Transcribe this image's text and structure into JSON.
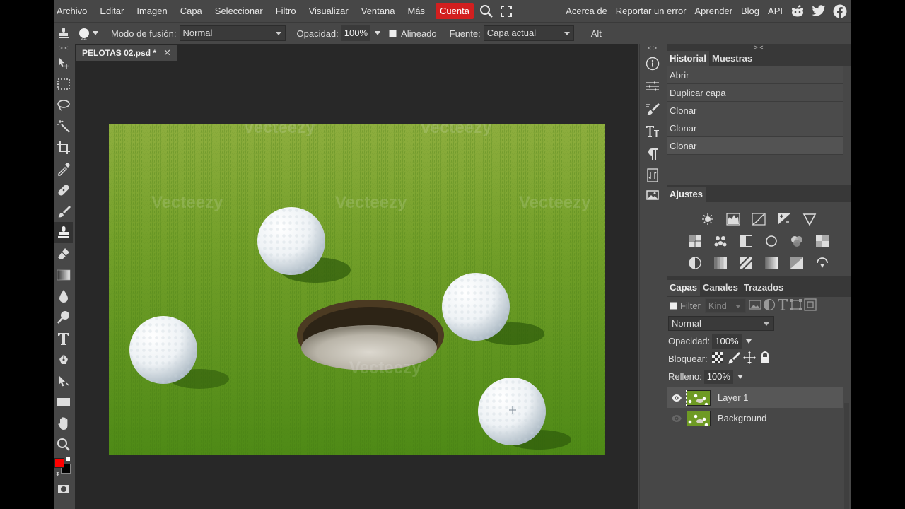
{
  "menu": {
    "items": [
      "Archivo",
      "Editar",
      "Imagen",
      "Capa",
      "Seleccionar",
      "Filtro",
      "Visualizar",
      "Ventana",
      "Más"
    ],
    "account": "Cuenta",
    "right_links": [
      "Acerca de",
      "Reportar un error",
      "Aprender",
      "Blog",
      "API"
    ],
    "social_icons": [
      "reddit-icon",
      "twitter-icon",
      "facebook-icon"
    ],
    "accent_color": "#d21f1f"
  },
  "options": {
    "blend_label": "Modo de fusión:",
    "blend_value": "Normal",
    "opacity_label": "Opacidad:",
    "opacity_value": "100%",
    "aligned_label": "Alineado",
    "source_label": "Fuente:",
    "source_value": "Capa actual",
    "alt_label": "Alt",
    "brush_size": "44"
  },
  "document": {
    "tab_title": "PELOTAS 02.psd *",
    "watermark": "Vecteezy"
  },
  "history": {
    "tabs": [
      "Historial",
      "Muestras"
    ],
    "items": [
      "Abrir",
      "Duplicar capa",
      "Clonar",
      "Clonar",
      "Clonar"
    ]
  },
  "adjustments": {
    "title": "Ajustes"
  },
  "layers": {
    "tabs": [
      "Capas",
      "Canales",
      "Trazados"
    ],
    "filter_label": "Filter",
    "kind_value": "Kind",
    "blend_value": "Normal",
    "opacity_label": "Opacidad:",
    "opacity_value": "100%",
    "lock_label": "Bloquear:",
    "fill_label": "Relleno:",
    "fill_value": "100%",
    "items": [
      {
        "name": "Layer 1",
        "selected": true
      },
      {
        "name": "Background",
        "selected": false
      }
    ]
  },
  "colors": {
    "foreground": "#ff0000",
    "background": "#000000"
  }
}
